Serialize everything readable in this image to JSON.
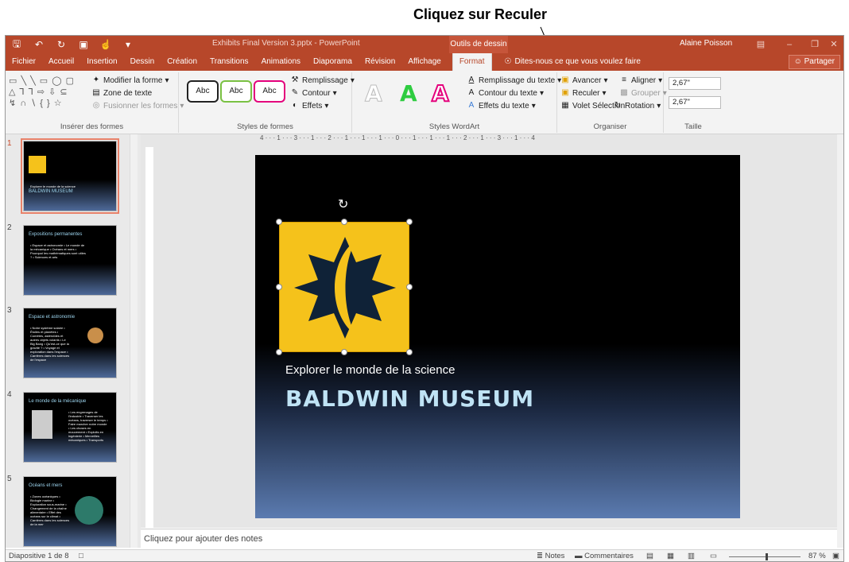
{
  "callout": "Cliquez sur Reculer",
  "titlebar": {
    "doc_title": "Exhibits Final Version 3.pptx - PowerPoint",
    "contextual": "Outils de dessin",
    "user": "Alaine Poisson"
  },
  "tabs": [
    "Fichier",
    "Accueil",
    "Insertion",
    "Dessin",
    "Création",
    "Transitions",
    "Animations",
    "Diaporama",
    "Révision",
    "Affichage"
  ],
  "active_tab": "Format",
  "tell_me": "Dites-nous ce que vous voulez faire",
  "share": "Partager",
  "ribbon": {
    "insert_shapes": {
      "edit_shape": "Modifier la forme",
      "text_box": "Zone de texte",
      "merge": "Fusionner les formes",
      "label": "Insérer des formes"
    },
    "shape_styles": {
      "abc": "Abc",
      "fill": "Remplissage",
      "outline": "Contour",
      "effects": "Effets",
      "label": "Styles de formes"
    },
    "wordart": {
      "letter": "A",
      "text_fill": "Remplissage du texte",
      "text_outline": "Contour du texte",
      "text_effects": "Effets du texte",
      "label": "Styles WordArt"
    },
    "arrange": {
      "forward": "Avancer",
      "backward": "Reculer",
      "selection": "Volet Sélection",
      "align": "Aligner",
      "group": "Grouper",
      "rotate": "Rotation",
      "label": "Organiser"
    },
    "size": {
      "height": "2,67\"",
      "width": "2,67\"",
      "label": "Taille"
    }
  },
  "ruler_top": "4 · · · 1 · · · 3 · · · 1 · · · 2 · · · 1 · · · 1 · · · 1 · · · 0 · · · 1 · · · 1 · · · 1 · · · 2 · · · 1 · · · 3 · · · 1 · · · 4",
  "slides": [
    {
      "num": "1",
      "title": "BALDWIN MUSEUM",
      "sub": "Explorer le monde de la science"
    },
    {
      "num": "2",
      "title": "Expositions permanentes",
      "bullets": "• Espace et astronomie • Le monde de la mécanique • Océans et mers • Pourquoi les mathématiques sont utiles ? • Sciences et arts"
    },
    {
      "num": "3",
      "title": "Espace et astronomie",
      "bullets": "• Notre système solaire • Étoiles et planètes • Comètes, astéroïdes et autres objets volants • Le Big Bang • Qu'est-ce que la gravité ? • Voyage et exploration dans l'espace • Carrières dans les sciences de l'espace"
    },
    {
      "num": "4",
      "title": "Le monde de la mécanique",
      "bullets": "• Les engrenages de l'industrie • Traverser les océans, traverser le temps • Faire marcher notre monde • Les choses en mouvement • Exploits en ingénierie • Merveilles mécaniques • Transports"
    },
    {
      "num": "5",
      "title": "Océans et mers",
      "bullets": "• Zones océaniques • Biologie marine • Exploration sous-marine • Changement de la chaîne alimentaire • Effet des océans sur le climat • Carrières dans les sciences de la mer"
    }
  ],
  "slide": {
    "subtitle": "Explorer le monde de la science",
    "title": "BALDWIN MUSEUM"
  },
  "notes_placeholder": "Cliquez pour ajouter des notes",
  "status": {
    "slide_count": "Diapositive 1 de 8",
    "notes": "Notes",
    "comments": "Commentaires",
    "zoom": "87 %"
  }
}
